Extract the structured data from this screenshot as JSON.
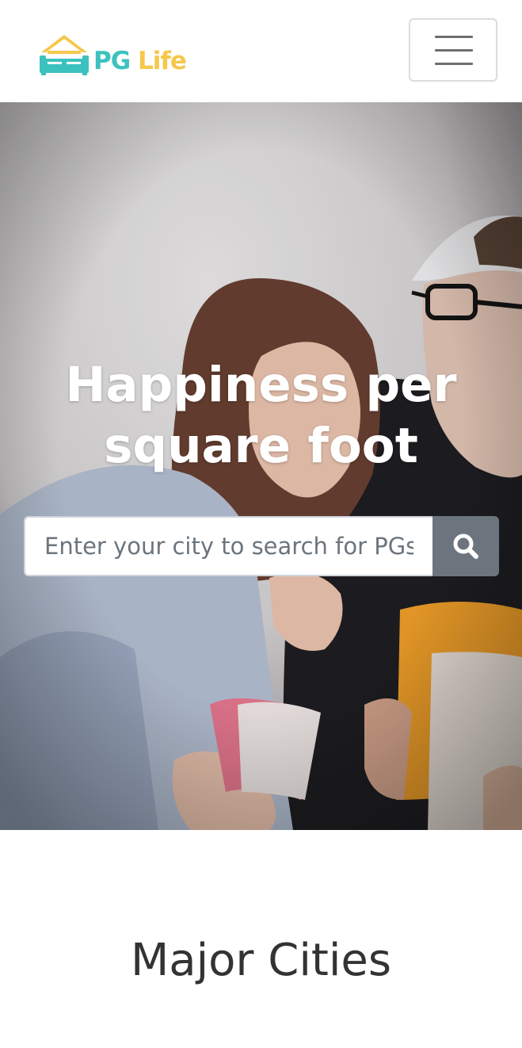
{
  "brand": {
    "name_part1": "PG",
    "name_part2": "Life",
    "colors": {
      "teal": "#3cc2be",
      "yellow": "#f5c84c"
    },
    "icon": "house-sofa-logo-icon"
  },
  "navbar": {
    "toggler_icon": "hamburger-menu-icon"
  },
  "hero": {
    "title_line1": "Happiness per",
    "title_line2": "square foot",
    "search": {
      "placeholder": "Enter your city to search for PGs",
      "value": "",
      "button_icon": "search-icon"
    }
  },
  "cities": {
    "heading": "Major Cities"
  }
}
